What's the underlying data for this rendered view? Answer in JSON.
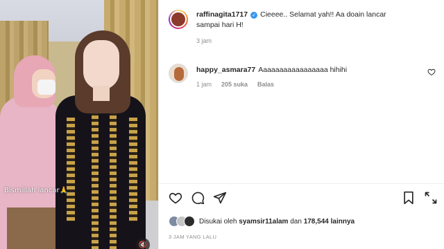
{
  "video": {
    "caption": "Bismillah lancar🙏"
  },
  "comments": [
    {
      "username": "raffinagita1717",
      "verified": true,
      "text": "Cieeee.. Selamat yah!! Aa doain lancar sampai hari H!",
      "time": "3 jam"
    },
    {
      "username": "happy_asmara77",
      "verified": false,
      "text": "Aaaaaaaaaaaaaaaaa hihihi",
      "time": "1 jam",
      "likes": "205 suka",
      "reply": "Balas"
    }
  ],
  "likes": {
    "prefix": "Disukai oleh",
    "user": "syamsir11alam",
    "middle": "dan",
    "count": "178,544 lainnya"
  },
  "timeago": "3 JAM YANG LALU",
  "icons": [
    "heart-icon",
    "comment-icon",
    "share-icon",
    "bookmark-icon",
    "fullscreen-icon",
    "mute-icon"
  ]
}
